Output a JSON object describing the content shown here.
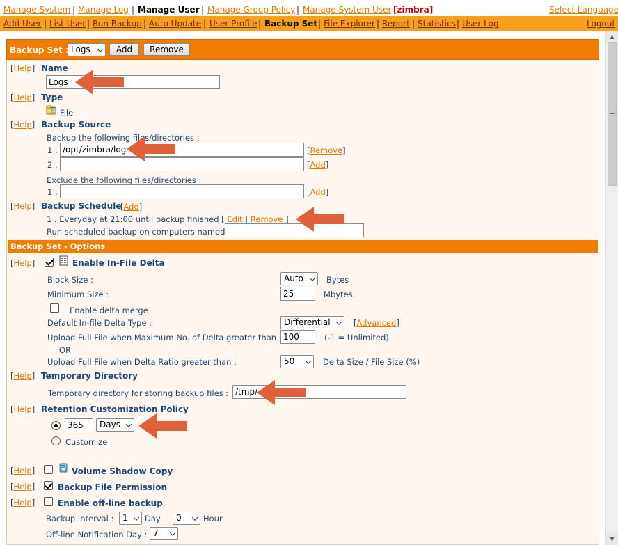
{
  "nav_top": {
    "items": [
      "Manage System",
      "Manage Log",
      "Manage User",
      "Manage Group Policy",
      "Manage System User"
    ],
    "user": "zimbra",
    "select_language": "Select Language"
  },
  "nav_sub": {
    "items": [
      "Add User",
      "List User",
      "Run Backup",
      "Auto Update",
      "User Profile",
      "Backup Set",
      "File Explorer",
      "Report",
      "Statistics",
      "User Log"
    ],
    "logout": "Logout"
  },
  "backup_set_bar": {
    "label": "Backup Set :",
    "selected": "Logs",
    "add_label": "Add",
    "remove_label": "Remove"
  },
  "help_label": "Help",
  "name_section": {
    "title": "Name",
    "value": "Logs"
  },
  "type_section": {
    "title": "Type",
    "value": "File"
  },
  "source_section": {
    "title": "Backup Source",
    "include_label": "Backup the following files/directories :",
    "include_rows": [
      {
        "index": "1 .",
        "value": "/opt/zimbra/log",
        "action": "Remove"
      },
      {
        "index": "2 .",
        "value": "",
        "action": "Add"
      }
    ],
    "exclude_label": "Exclude the following files/directories :",
    "exclude_rows": [
      {
        "index": "1 .",
        "value": "",
        "action": "Add"
      }
    ]
  },
  "schedule_section": {
    "title": "Backup Schedule",
    "add_label": "Add",
    "entry_text": "1 . Everyday at 21:00 until backup finished [",
    "edit_label": "Edit",
    "remove_label": "Remove",
    "computers_label": "Run scheduled backup on computers named",
    "computers_value": ""
  },
  "options_bar": {
    "label": "Backup Set - Options"
  },
  "in_file_delta": {
    "title": "Enable In-File Delta",
    "enabled": true,
    "block_size_label": "Block Size :",
    "block_size_value": "Auto",
    "block_size_unit": "Bytes",
    "min_size_label": "Minimum Size :",
    "min_size_value": "25",
    "min_size_unit": "Mbytes",
    "delta_merge_label": "Enable delta merge",
    "delta_type_label": "Default In-file Delta Type :",
    "delta_type_value": "Differential",
    "advanced_label": "Advanced",
    "max_no_label": "Upload Full File when Maximum No. of Delta greater than :",
    "max_no_value": "100",
    "max_no_note": "(-1 = Unlimited)",
    "or_label": "OR",
    "ratio_label": "Upload Full File when Delta Ratio greater than :",
    "ratio_value": "50",
    "ratio_note": "Delta Size / File Size (%)"
  },
  "temp_dir": {
    "title": "Temporary Directory",
    "label": "Temporary directory for storing backup files :",
    "value": "/tmp/"
  },
  "retention": {
    "title": "Retention Customization Policy",
    "days_value": "365",
    "unit_value": "Days",
    "customize_label": "Customize"
  },
  "vss": {
    "title": "Volume Shadow Copy",
    "enabled": false
  },
  "file_permission": {
    "title": "Backup File Permission",
    "enabled": true
  },
  "offline": {
    "title": "Enable off-line backup",
    "enabled": false,
    "interval_label": "Backup Interval :",
    "day_value": "1",
    "day_label": "Day",
    "hour_value": "0",
    "hour_label": "Hour",
    "notification_label": "Off-line Notification Day :",
    "notification_value": "7"
  },
  "colors": {
    "accent": "#f07d00",
    "link": "#e07b00",
    "label": "#1b4a78",
    "arrow": "#e0603a",
    "user": "#cc0000"
  }
}
